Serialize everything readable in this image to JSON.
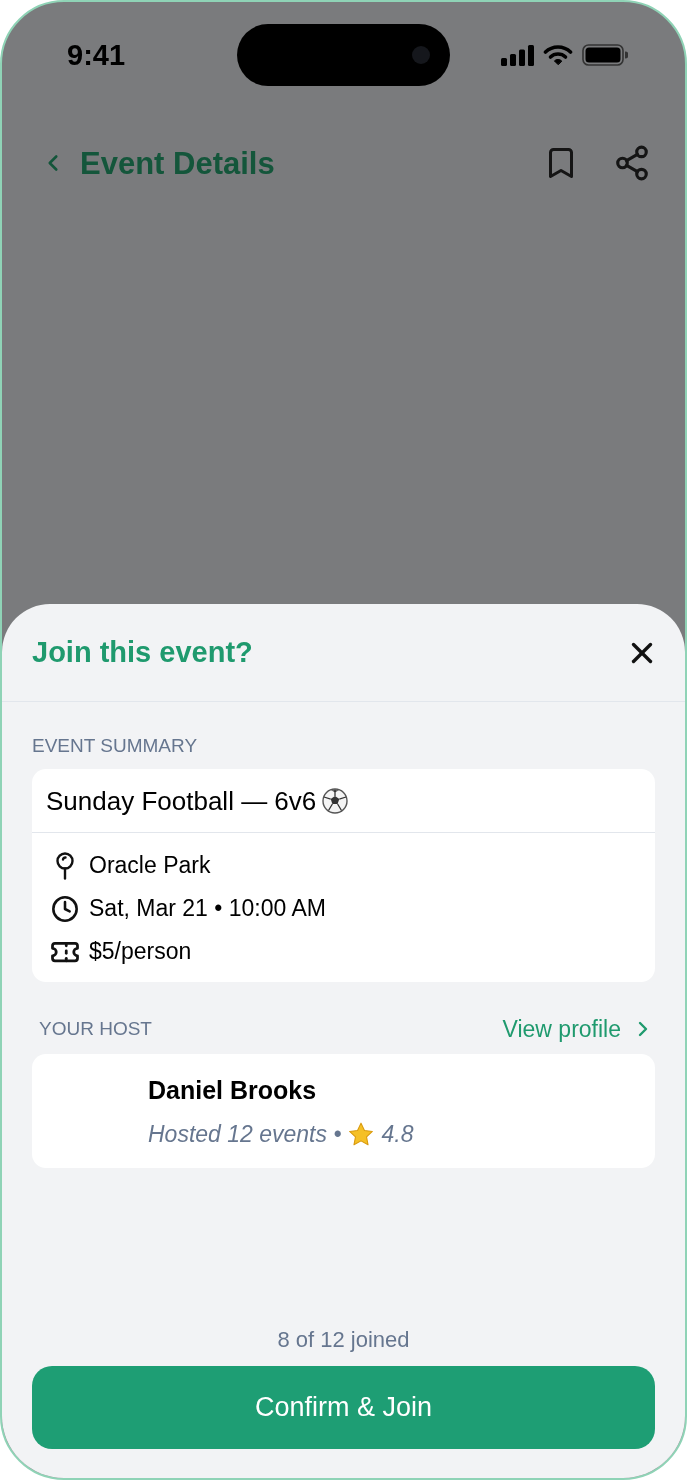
{
  "status_bar": {
    "time": "9:41"
  },
  "header": {
    "title": "Event Details"
  },
  "sheet": {
    "title": "Join this event?",
    "summary": {
      "label": "EVENT SUMMARY",
      "title": "Sunday Football — 6v6",
      "details": [
        {
          "kind": "location",
          "text": "Oracle Park"
        },
        {
          "kind": "time",
          "text": "Sat, Mar 21 • 10:00 AM"
        },
        {
          "kind": "price",
          "text": "$5/person"
        }
      ]
    },
    "host": {
      "label": "YOUR HOST",
      "link": "View profile",
      "name": "Daniel Brooks",
      "stats": "Hosted 12 events •",
      "rating": "4.8"
    },
    "capacity": "8 of 12 joined",
    "button": "Confirm & Join"
  }
}
